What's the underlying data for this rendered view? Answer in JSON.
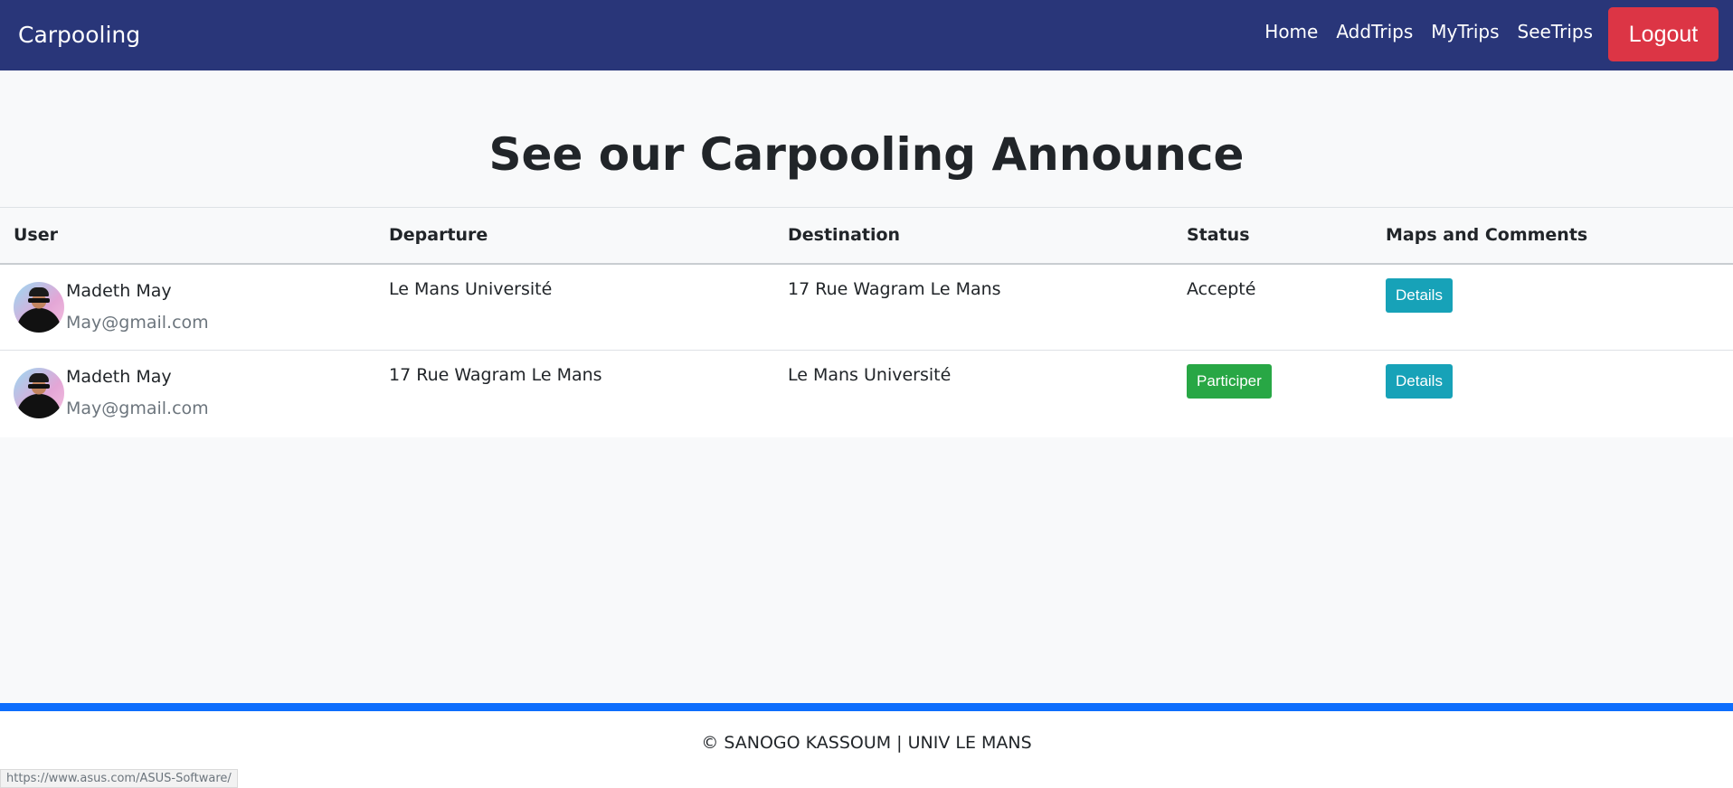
{
  "navbar": {
    "brand": "Carpooling",
    "links": [
      "Home",
      "AddTrips",
      "MyTrips",
      "SeeTrips"
    ],
    "logout_label": "Logout"
  },
  "page_title": "See our Carpooling Announce",
  "table": {
    "headers": [
      "User",
      "Departure",
      "Destination",
      "Status",
      "Maps and Comments"
    ],
    "rows": [
      {
        "user_name": "Madeth May",
        "user_email": "May@gmail.com",
        "departure": "Le Mans Université",
        "destination": "17 Rue Wagram Le Mans",
        "status": "Accepté",
        "details_label": "Details"
      },
      {
        "user_name": "Madeth May",
        "user_email": "May@gmail.com",
        "departure": "17 Rue Wagram Le Mans",
        "destination": "Le Mans Université",
        "status_button": "Participer",
        "details_label": "Details"
      }
    ]
  },
  "footer": {
    "text": "© SANOGO KASSOUM | UNIV LE MANS"
  },
  "status_bar_url": "https://www.asus.com/ASUS-Software/",
  "colors": {
    "navbar_bg": "#293679",
    "logout": "#dc3545",
    "details": "#17a2b8",
    "participer": "#28a745",
    "footer_accent": "#0d6efd"
  }
}
